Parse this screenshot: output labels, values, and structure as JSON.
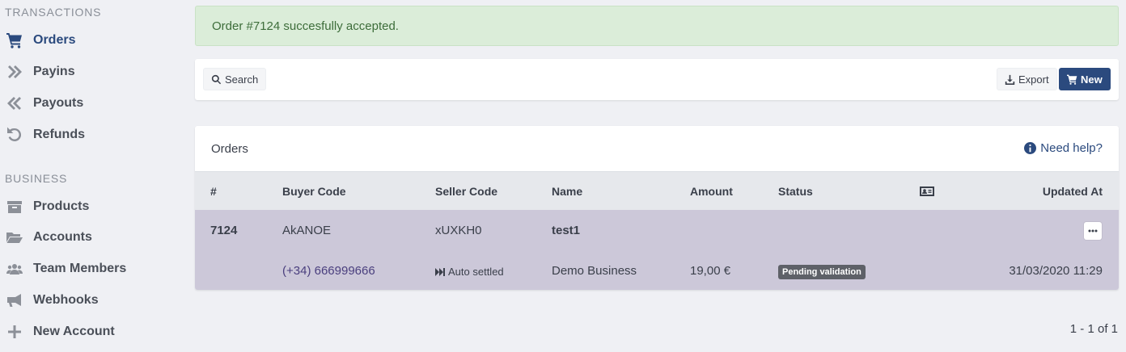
{
  "sidebar": {
    "transactions_title": "TRANSACTIONS",
    "business_title": "BUSINESS",
    "items": [
      {
        "label": "Orders",
        "icon": "cart-icon",
        "active": true
      },
      {
        "label": "Payins",
        "icon": "double-chevron-right-icon"
      },
      {
        "label": "Payouts",
        "icon": "double-chevron-left-icon"
      },
      {
        "label": "Refunds",
        "icon": "undo-icon"
      },
      {
        "label": "Products",
        "icon": "box-icon"
      },
      {
        "label": "Accounts",
        "icon": "folder-open-icon"
      },
      {
        "label": "Team Members",
        "icon": "users-icon"
      },
      {
        "label": "Webhooks",
        "icon": "megaphone-icon"
      },
      {
        "label": "New Account",
        "icon": "plus-icon"
      }
    ]
  },
  "alert": {
    "message": "Order #7124 succesfully accepted."
  },
  "toolbar": {
    "search_label": "Search",
    "export_label": "Export",
    "new_label": "New"
  },
  "orders": {
    "title": "Orders",
    "help_label": "Need help?",
    "columns": {
      "id": "#",
      "buyer_code": "Buyer Code",
      "seller_code": "Seller Code",
      "name": "Name",
      "amount": "Amount",
      "status": "Status",
      "updated_at": "Updated At"
    },
    "rows": [
      {
        "id": "7124",
        "buyer_code": "AkANOE",
        "buyer_phone": "(+34) 666999666",
        "seller_code": "xUXKH0",
        "settlement": "Auto settled",
        "name": "test1",
        "business": "Demo Business",
        "amount": "19,00 €",
        "status": "Pending validation",
        "updated_at": "31/03/2020 11:29"
      }
    ]
  },
  "pagination": {
    "label": "1 - 1 of 1"
  },
  "colors": {
    "primary": "#2b4a7e",
    "alert_bg": "#dbedd9",
    "alert_text": "#3d6d3a",
    "row_highlight": "#ccc8d9",
    "badge_bg": "#5e6168"
  }
}
